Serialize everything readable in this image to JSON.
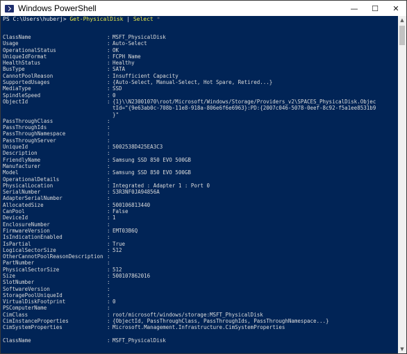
{
  "window": {
    "title": "Windows PowerShell",
    "minimize": "—",
    "maximize": "☐",
    "close": "✕"
  },
  "prompt": {
    "path": "PS C:\\Users\\huberj> ",
    "cmd1": "Get-PhysicalDisk",
    "pipe": " | ",
    "cmd2": "Select",
    "star": " *"
  },
  "rows": [
    {
      "k": "ClassName",
      "v": "MSFT_PhysicalDisk"
    },
    {
      "k": "Usage",
      "v": "Auto-Select"
    },
    {
      "k": "OperationalStatus",
      "v": "OK"
    },
    {
      "k": "UniqueIdFormat",
      "v": "FCPH Name"
    },
    {
      "k": "HealthStatus",
      "v": "Healthy"
    },
    {
      "k": "BusType",
      "v": "SATA"
    },
    {
      "k": "CannotPoolReason",
      "v": "Insufficient Capacity"
    },
    {
      "k": "SupportedUsages",
      "v": "{Auto-Select, Manual-Select, Hot Spare, Retired...}"
    },
    {
      "k": "MediaType",
      "v": "SSD"
    },
    {
      "k": "SpindleSpeed",
      "v": "0"
    },
    {
      "k": "ObjectId",
      "v": "{1}\\\\N23001070\\root/Microsoft/Windows/Storage/Providers_v2\\SPACES_PhysicalDisk.Objec"
    },
    {
      "k": "",
      "v": "tId=\"{9e63ab0c-708b-11e8-918a-806e6f6e6963}:PD:{2007c046-5078-0eef-8c92-f5a1ee8531b9"
    },
    {
      "k": "",
      "v": "}\""
    },
    {
      "k": "PassThroughClass",
      "v": ""
    },
    {
      "k": "PassThroughIds",
      "v": ""
    },
    {
      "k": "PassThroughNamespace",
      "v": ""
    },
    {
      "k": "PassThroughServer",
      "v": ""
    },
    {
      "k": "UniqueId",
      "v": "5002538D425EA3C3"
    },
    {
      "k": "Description",
      "v": ""
    },
    {
      "k": "FriendlyName",
      "v": "Samsung SSD 850 EVO 500GB"
    },
    {
      "k": "Manufacturer",
      "v": ""
    },
    {
      "k": "Model",
      "v": "Samsung SSD 850 EVO 500GB"
    },
    {
      "k": "OperationalDetails",
      "v": ""
    },
    {
      "k": "PhysicalLocation",
      "v": "Integrated : Adapter 1 : Port 0"
    },
    {
      "k": "SerialNumber",
      "v": "S3R3NF0JA94856A"
    },
    {
      "k": "AdapterSerialNumber",
      "v": ""
    },
    {
      "k": "AllocatedSize",
      "v": "500106813440"
    },
    {
      "k": "CanPool",
      "v": "False"
    },
    {
      "k": "DeviceId",
      "v": "1"
    },
    {
      "k": "EnclosureNumber",
      "v": ""
    },
    {
      "k": "FirmwareVersion",
      "v": "EMT03B6Q"
    },
    {
      "k": "IsIndicationEnabled",
      "v": ""
    },
    {
      "k": "IsPartial",
      "v": "True"
    },
    {
      "k": "LogicalSectorSize",
      "v": "512"
    },
    {
      "k": "OtherCannotPoolReasonDescription",
      "v": ""
    },
    {
      "k": "PartNumber",
      "v": ""
    },
    {
      "k": "PhysicalSectorSize",
      "v": "512"
    },
    {
      "k": "Size",
      "v": "500107862016"
    },
    {
      "k": "SlotNumber",
      "v": ""
    },
    {
      "k": "SoftwareVersion",
      "v": ""
    },
    {
      "k": "StoragePoolUniqueId",
      "v": ""
    },
    {
      "k": "VirtualDiskFootprint",
      "v": "0"
    },
    {
      "k": "PSComputerName",
      "v": ""
    },
    {
      "k": "CimClass",
      "v": "root/microsoft/windows/storage:MSFT_PhysicalDisk"
    },
    {
      "k": "CimInstanceProperties",
      "v": "{ObjectId, PassThroughClass, PassThroughIds, PassThroughNamespace...}"
    },
    {
      "k": "CimSystemProperties",
      "v": "Microsoft.Management.Infrastructure.CimSystemProperties"
    },
    {
      "k": "__blank__",
      "v": ""
    },
    {
      "k": "ClassName",
      "v": "MSFT_PhysicalDisk"
    }
  ]
}
